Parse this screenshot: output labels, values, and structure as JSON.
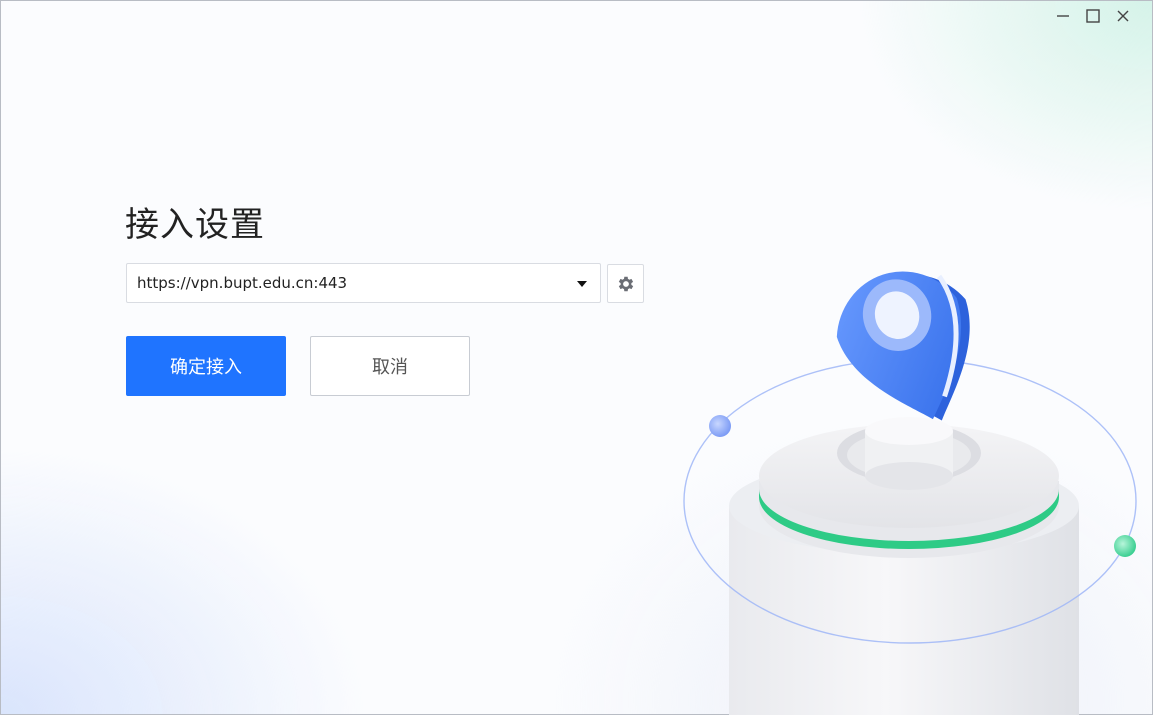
{
  "window": {
    "controls": [
      "minimize-icon",
      "maximize-icon",
      "close-icon"
    ]
  },
  "page": {
    "title": "接入设置"
  },
  "server": {
    "selected": "https://vpn.bupt.edu.cn:443"
  },
  "buttons": {
    "confirm_label": "确定接入",
    "cancel_label": "取消"
  },
  "colors": {
    "primary": "#1f74ff",
    "accent_green": "#2ecb86",
    "pin_blue": "#3f7af2"
  }
}
